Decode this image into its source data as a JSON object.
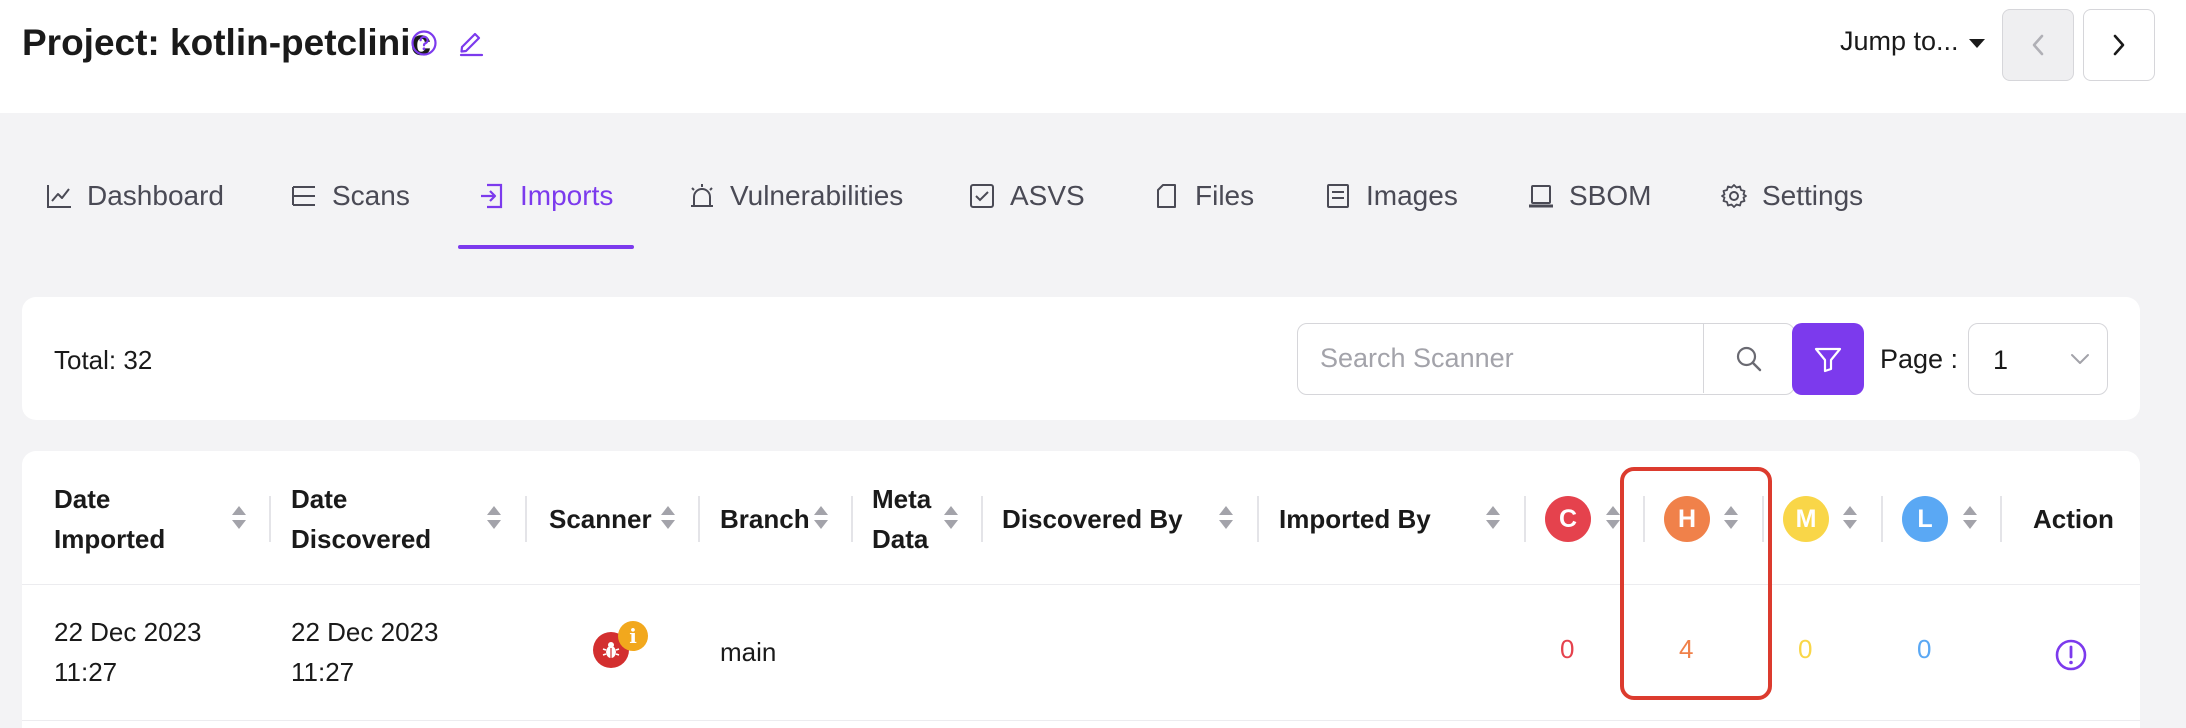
{
  "header": {
    "project_title": "Project: kotlin-petclinic",
    "jump_label": "Jump to..."
  },
  "tabs": [
    {
      "label": "Dashboard",
      "icon": "chart-line-icon",
      "active": false
    },
    {
      "label": "Scans",
      "icon": "list-icon",
      "active": false
    },
    {
      "label": "Imports",
      "icon": "import-icon",
      "active": true
    },
    {
      "label": "Vulnerabilities",
      "icon": "alarm-icon",
      "active": false
    },
    {
      "label": "ASVS",
      "icon": "checkbox-icon",
      "active": false
    },
    {
      "label": "Files",
      "icon": "file-icon",
      "active": false
    },
    {
      "label": "Images",
      "icon": "server-icon",
      "active": false
    },
    {
      "label": "SBOM",
      "icon": "laptop-icon",
      "active": false
    },
    {
      "label": "Settings",
      "icon": "gear-icon",
      "active": false
    }
  ],
  "toolbar": {
    "total": "Total: 32",
    "search_placeholder": "Search Scanner",
    "page_label": "Page :",
    "page_value": "1"
  },
  "table": {
    "columns": {
      "date_imported": [
        "Date",
        "Imported"
      ],
      "date_discovered": [
        "Date",
        "Discovered"
      ],
      "scanner": "Scanner",
      "branch": "Branch",
      "meta_data": [
        "Meta",
        "Data"
      ],
      "discovered_by": "Discovered By",
      "imported_by": "Imported By",
      "critical": "C",
      "high": "H",
      "medium": "M",
      "low": "L",
      "action": "Action"
    },
    "rows": [
      {
        "date_imported": [
          "22 Dec 2023",
          "11:27"
        ],
        "date_discovered": [
          "22 Dec 2023",
          "11:27"
        ],
        "scanner_badge": "i",
        "branch": "main",
        "critical": "0",
        "high": "4",
        "medium": "0",
        "low": "0"
      }
    ]
  },
  "colors": {
    "accent": "#7c3aed",
    "critical": "#e5424d",
    "high": "#f0814a",
    "medium": "#f9d648",
    "low": "#5aa8f4",
    "highlight": "#dc3b2e"
  }
}
